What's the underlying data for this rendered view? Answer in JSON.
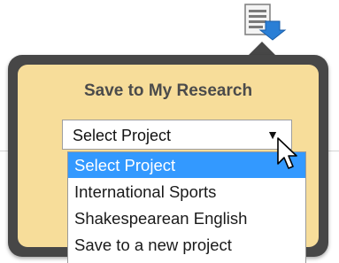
{
  "popover": {
    "title": "Save to My Research"
  },
  "project_select": {
    "value": "Select Project",
    "caret_glyph": "▼"
  },
  "dropdown": {
    "options": [
      {
        "label": "Select Project",
        "selected": true
      },
      {
        "label": "International Sports",
        "selected": false
      },
      {
        "label": "Shakespearean English",
        "selected": false
      },
      {
        "label": "Save to a new project",
        "selected": false
      }
    ]
  },
  "icons": {
    "save": "save-to-research-icon",
    "cursor": "mouse-pointer-icon"
  },
  "colors": {
    "popover_frame": "#474747",
    "popover_fill": "#f7dd9a",
    "selection": "#3399ff",
    "icon_arrow": "#2a7fd6"
  }
}
